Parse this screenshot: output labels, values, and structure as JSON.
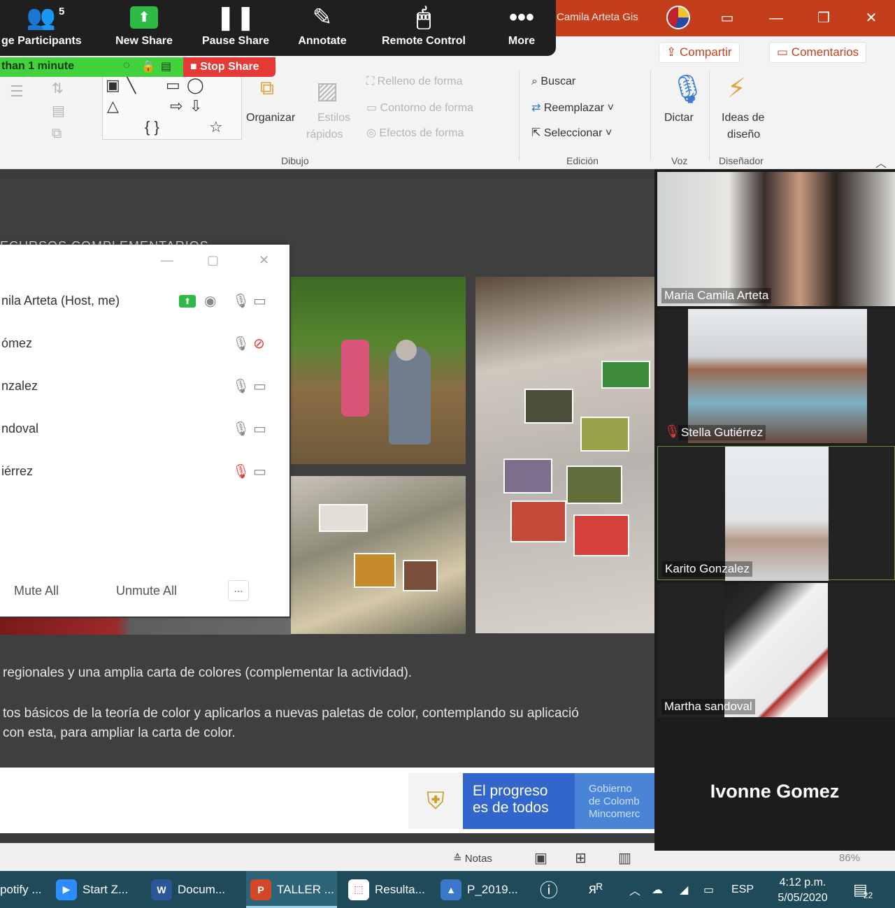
{
  "colors": {
    "ppt_accent": "#c43e1c",
    "zoom_green": "#2dbb45",
    "stop_red": "#e53935",
    "taskbar": "#1e4a5a",
    "gov_blue": "#3366cc"
  },
  "ppt": {
    "user_name": "Camila Arteta Gis",
    "share_label": "Compartir",
    "comments_label": "Comentarios",
    "ribbon": {
      "organize": "Organizar",
      "quick_styles_1": "Estilos",
      "quick_styles_2": "rápidos",
      "shape_fill": "Relleno de forma",
      "shape_outline": "Contorno de forma",
      "shape_effects": "Efectos de forma",
      "drawing_group": "Dibujo",
      "find": "Buscar",
      "replace": "Reemplazar",
      "select": "Seleccionar",
      "editing_group": "Edición",
      "dictate": "Dictar",
      "voice_group": "Voz",
      "design_ideas_1": "Ideas de",
      "design_ideas_2": "diseño",
      "designer_group": "Diseñador"
    }
  },
  "zoom_toolbar": {
    "participants_count": "5",
    "participants_label": "ge Participants",
    "new_share": "New Share",
    "pause_share": "Pause Share",
    "annotate": "Annotate",
    "remote_control": "Remote Control",
    "more": "More",
    "timer_text": "than 1 minute",
    "stop_share": "Stop Share"
  },
  "slide": {
    "heading": "ECURSOS COMPLEMENTARIOS",
    "line1": "regionales y una amplia carta de colores (complementar la actividad).",
    "line2": "tos básicos de la teoría de color y aplicarlos a nuevas paletas de color, contemplando su aplicació",
    "line3": "con esta, para ampliar la carta de color.",
    "gov_line1": "El progreso",
    "gov_line2": "es de todos",
    "gov_right_1": "Gobierno",
    "gov_right_2": "de Colomb",
    "gov_right_3": "Mincomerc"
  },
  "participants_panel": {
    "rows": [
      {
        "name": "nila Arteta (Host, me)"
      },
      {
        "name": "ómez"
      },
      {
        "name": "nzalez"
      },
      {
        "name": "ndoval"
      },
      {
        "name": "iérrez"
      }
    ],
    "mute_all": "Mute All",
    "unmute_all": "Unmute All",
    "more": "..."
  },
  "gallery": {
    "tiles": [
      {
        "name": "Maria Camila Arteta"
      },
      {
        "name": "Stella Gutiérrez"
      },
      {
        "name": "Karito Gonzalez"
      },
      {
        "name": "Martha sandoval"
      }
    ],
    "no_video_name": "Ivonne Gomez"
  },
  "statusbar": {
    "notes": "Notas",
    "zoom": "86%"
  },
  "taskbar": {
    "items": [
      {
        "label": "potify ...",
        "icon": "spotify-icon"
      },
      {
        "label": "Start Z...",
        "icon": "zoom-icon"
      },
      {
        "label": "Docum...",
        "icon": "word-icon"
      },
      {
        "label": "TALLER ...",
        "icon": "powerpoint-icon"
      },
      {
        "label": "Resulta...",
        "icon": "pdf-icon"
      },
      {
        "label": "P_2019...",
        "icon": "photos-icon"
      }
    ],
    "language": "ESP",
    "time": "4:12 p.m.",
    "date": "5/05/2020",
    "notifications": "22"
  }
}
